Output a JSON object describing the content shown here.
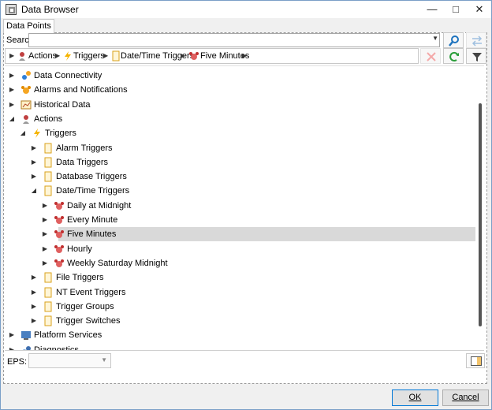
{
  "window": {
    "title": "Data Browser"
  },
  "tabs": [
    "Data Points"
  ],
  "search": {
    "label": "Search:",
    "value": ""
  },
  "breadcrumb": [
    "Actions",
    "Triggers",
    "Date/Time Triggers",
    "Five Minutes"
  ],
  "tree": [
    {
      "label": "Data Connectivity",
      "icon": "data-connectivity-icon",
      "expanded": false
    },
    {
      "label": "Alarms and Notifications",
      "icon": "alarm-bell-icon",
      "expanded": false
    },
    {
      "label": "Historical Data",
      "icon": "historical-data-icon",
      "expanded": false
    },
    {
      "label": "Actions",
      "icon": "actions-icon",
      "expanded": true
    },
    {
      "label": "Triggers",
      "icon": "lightning-icon",
      "expanded": true
    },
    {
      "label": "Alarm Triggers",
      "icon": "folder-icon",
      "expanded": false
    },
    {
      "label": "Data Triggers",
      "icon": "folder-icon",
      "expanded": false
    },
    {
      "label": "Database Triggers",
      "icon": "folder-icon",
      "expanded": false
    },
    {
      "label": "Date/Time Triggers",
      "icon": "folder-icon",
      "expanded": true
    },
    {
      "label": "Daily at Midnight",
      "icon": "alarm-clock-icon",
      "expanded": false
    },
    {
      "label": "Every Minute",
      "icon": "alarm-clock-icon",
      "expanded": false
    },
    {
      "label": "Five Minutes",
      "icon": "alarm-clock-icon",
      "expanded": false,
      "selected": true
    },
    {
      "label": "Hourly",
      "icon": "alarm-clock-icon",
      "expanded": false
    },
    {
      "label": "Weekly Saturday Midnight",
      "icon": "alarm-clock-icon",
      "expanded": false
    },
    {
      "label": "File Triggers",
      "icon": "folder-icon",
      "expanded": false
    },
    {
      "label": "NT Event Triggers",
      "icon": "folder-icon",
      "expanded": false
    },
    {
      "label": "Trigger Groups",
      "icon": "folder-icon",
      "expanded": false
    },
    {
      "label": "Trigger Switches",
      "icon": "folder-icon",
      "expanded": false
    },
    {
      "label": "Platform Services",
      "icon": "platform-services-icon",
      "expanded": false
    },
    {
      "label": "Diagnostics",
      "icon": "diagnostics-icon",
      "expanded": false
    }
  ],
  "eps": {
    "label": "EPS:",
    "value": ""
  },
  "buttons": {
    "ok": "OK",
    "cancel": "Cancel"
  },
  "colors": {
    "selection": "#d9d9d9",
    "accent": "#0078d7"
  }
}
